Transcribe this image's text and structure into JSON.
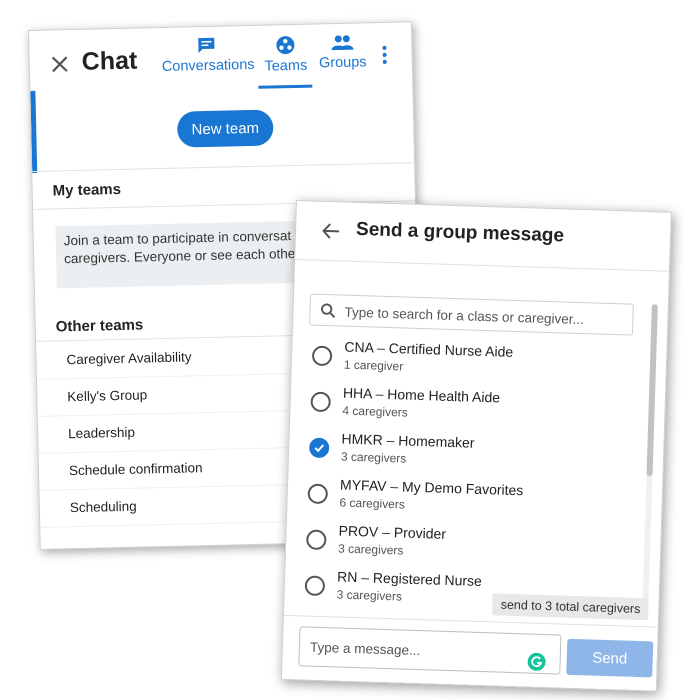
{
  "chat": {
    "title": "Chat",
    "tabs": [
      {
        "label": "Conversations",
        "icon": "chat-bubble-icon"
      },
      {
        "label": "Teams",
        "icon": "teams-icon",
        "active": true
      },
      {
        "label": "Groups",
        "icon": "groups-icon"
      }
    ],
    "new_team_label": "New team",
    "my_teams_heading": "My teams",
    "info_text": "Join a team to participate in conversat that team and caregivers. Everyone or see each other's messages.",
    "other_teams_heading": "Other teams",
    "other_teams": [
      "Caregiver Availability",
      "Kelly's Group",
      "Leadership",
      "Schedule confirmation",
      "Scheduling"
    ]
  },
  "group_message": {
    "title": "Send a group message",
    "search_placeholder": "Type to search for a class or caregiver...",
    "groups": [
      {
        "name": "CNA – Certified Nurse Aide",
        "count": "1 caregiver",
        "checked": false
      },
      {
        "name": "HHA – Home Health Aide",
        "count": "4 caregivers",
        "checked": false
      },
      {
        "name": "HMKR – Homemaker",
        "count": "3 caregivers",
        "checked": true
      },
      {
        "name": "MYFAV – My Demo Favorites",
        "count": "6 caregivers",
        "checked": false
      },
      {
        "name": "PROV – Provider",
        "count": "3 caregivers",
        "checked": false
      },
      {
        "name": "RN – Registered Nurse",
        "count": "3 caregivers",
        "checked": false
      }
    ],
    "send_summary": "send to 3 total caregivers",
    "message_placeholder": "Type a message...",
    "send_label": "Send"
  },
  "colors": {
    "accent": "#1976d2",
    "send_button": "#8fb6e8",
    "info_box": "#eceff1"
  }
}
